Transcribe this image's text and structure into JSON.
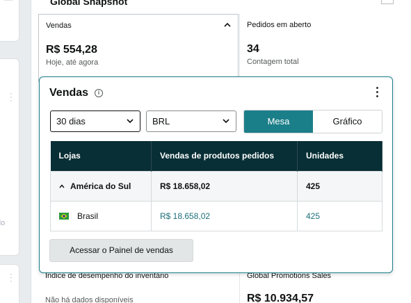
{
  "left_strip": {
    "badge": "0",
    "text_fragment": "do"
  },
  "panel": {
    "title": "Global Snapshot"
  },
  "tiles": {
    "vendas": {
      "label": "Vendas",
      "value": "R$ 554,28",
      "sub": "Hoje, até agora"
    },
    "pedidos": {
      "label": "Pedidos em aberto",
      "value": "34",
      "sub": "Contagem total"
    },
    "inventario": {
      "label": "Índice de desempenho do inventário",
      "sub": "Não há dados disponíveis"
    },
    "promotions": {
      "label": "Global Promotions Sales",
      "value": "R$ 10.934,57"
    }
  },
  "popover": {
    "title": "Vendas",
    "period_select": "30 dias",
    "currency_select": "BRL",
    "view_toggle": {
      "options": [
        "Mesa",
        "Gráfico"
      ],
      "selected": "Mesa"
    },
    "table": {
      "headers": [
        "Lojas",
        "Vendas de produtos pedidos",
        "Unidades"
      ],
      "group": {
        "name": "América do Sul",
        "sales": "R$ 18.658,02",
        "units": "425"
      },
      "rows": [
        {
          "store": "Brasil",
          "flag": "brazil-flag-icon",
          "sales": "R$ 18.658,02",
          "units": "425"
        }
      ]
    },
    "cta": "Acessar o Painel de vendas"
  },
  "colors": {
    "accent": "#1b7f89",
    "table_header": "#082f35",
    "link": "#1b6f79",
    "background": "#e9ecee"
  }
}
